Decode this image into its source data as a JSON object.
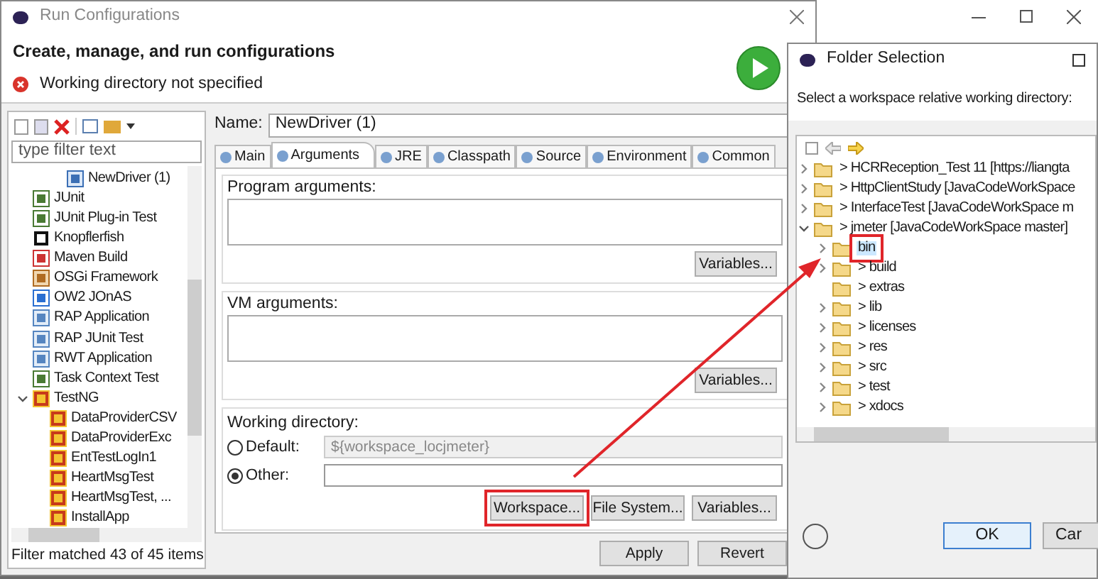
{
  "main_window": {
    "title": "Run Configurations",
    "heading": "Create, manage, and run configurations",
    "error": "Working directory not specified",
    "filter": {
      "placeholder": "type filter text"
    },
    "config_tree": [
      {
        "children": [
          {
            "label": "NewDriver (1)",
            "kind": "java"
          }
        ]
      },
      {
        "label": "JUnit",
        "kind": "junit"
      },
      {
        "label": "JUnit Plug-in Test",
        "kind": "junit"
      },
      {
        "label": "Knopflerfish",
        "kind": "knopflerfish"
      },
      {
        "label": "Maven Build",
        "kind": "maven"
      },
      {
        "label": "OSGi Framework",
        "kind": "osgi"
      },
      {
        "label": "OW2 JOnAS",
        "kind": "jonas"
      },
      {
        "label": "RAP Application",
        "kind": "rap"
      },
      {
        "label": "RAP JUnit Test",
        "kind": "rap"
      },
      {
        "label": "RWT Application",
        "kind": "rap"
      },
      {
        "label": "Task Context Test",
        "kind": "junit"
      },
      {
        "label": "TestNG",
        "kind": "testng",
        "expanded": true,
        "children": [
          {
            "label": "DataProviderCSV",
            "kind": "testng"
          },
          {
            "label": "DataProviderExc",
            "kind": "testng"
          },
          {
            "label": "EntTestLogIn1",
            "kind": "testng"
          },
          {
            "label": "HeartMsgTest",
            "kind": "testng"
          },
          {
            "label": "HeartMsgTest, ...",
            "kind": "testng"
          },
          {
            "label": "InstallApp",
            "kind": "testng"
          }
        ]
      }
    ],
    "filter_status": "Filter matched 43 of 45 items",
    "name_label": "Name:",
    "name_value": "NewDriver (1)",
    "tabs": [
      {
        "label": "Main",
        "selected": false
      },
      {
        "label": "Arguments",
        "selected": true
      },
      {
        "label": "JRE",
        "selected": false
      },
      {
        "label": "Classpath",
        "selected": false
      },
      {
        "label": "Source",
        "selected": false
      },
      {
        "label": "Environment",
        "selected": false
      },
      {
        "label": "Common",
        "selected": false
      }
    ],
    "program_arguments": {
      "label": "Program arguments:",
      "button": "Variables..."
    },
    "vm_arguments": {
      "label": "VM arguments:",
      "button": "Variables..."
    },
    "working_directory": {
      "label": "Working directory:",
      "options": [
        {
          "label": "Default:",
          "selected": false,
          "value": "${workspace_locjmeter}"
        },
        {
          "label": "Other:",
          "selected": true
        }
      ],
      "buttons": [
        {
          "label": "Workspace...",
          "highlighted": true
        },
        {
          "label": "File System...",
          "highlighted": false
        },
        {
          "label": "Variables...",
          "highlighted": false
        }
      ]
    },
    "buttons": [
      "Apply",
      "Revert"
    ]
  },
  "folder_dialog": {
    "title": "Folder Selection",
    "prompt": "Select a workspace relative working directory:",
    "tree": [
      {
        "label": "> HCRReception_Test 11 [https://liangta",
        "expanded": false,
        "selected": false
      },
      {
        "label": "> HttpClientStudy [JavaCodeWorkSpace",
        "expanded": false,
        "selected": false
      },
      {
        "label": "> InterfaceTest [JavaCodeWorkSpace m",
        "expanded": false,
        "selected": false
      },
      {
        "label": "> jmeter [JavaCodeWorkSpace master]",
        "expanded": true,
        "selected": false,
        "children": [
          {
            "label": "bin",
            "expanded": false,
            "selected": true
          },
          {
            "label": "> build",
            "expanded": false,
            "selected": false
          },
          {
            "label": "> extras",
            "selected": false
          },
          {
            "label": "> lib",
            "expanded": false,
            "selected": false
          },
          {
            "label": "> licenses",
            "expanded": false,
            "selected": false
          },
          {
            "label": "> res",
            "expanded": false,
            "selected": false
          },
          {
            "label": "> src",
            "expanded": false,
            "selected": false
          },
          {
            "label": "> test",
            "expanded": false,
            "selected": false
          },
          {
            "label": "> xdocs",
            "expanded": false,
            "selected": false
          }
        ]
      }
    ],
    "buttons": [
      "OK",
      "Car"
    ]
  }
}
